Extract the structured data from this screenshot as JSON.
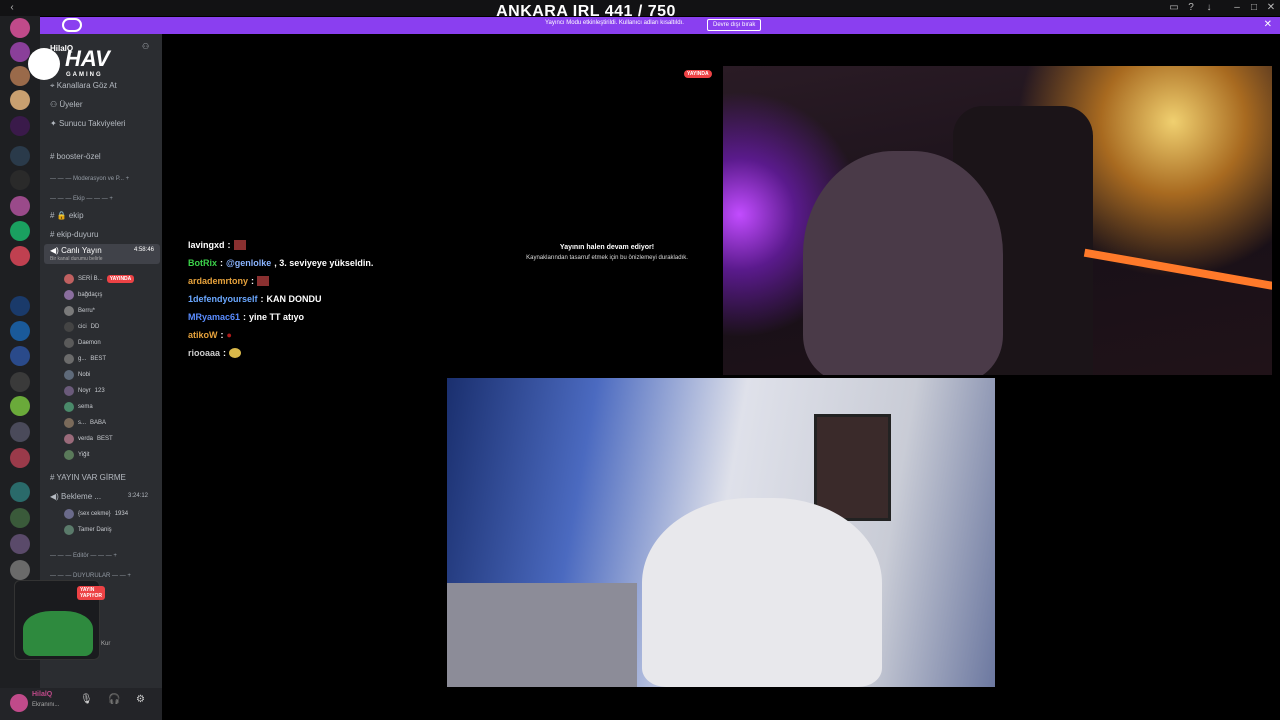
{
  "overlay": {
    "title": "ANKARA IRL 441 / 750"
  },
  "banner": {
    "message": "Yayıncı Modu etkinleştirildi. Kullanıcı adları kısaltıldı.",
    "button_label": "Devre dışı bırak",
    "close_glyph": "✕"
  },
  "server": {
    "name": "HilalQ",
    "logo_text": "HAV",
    "logo_sub": "GAMING"
  },
  "sidebar": {
    "channels": [
      {
        "label": "Kanallara Göz At",
        "icon": "compass-icon"
      },
      {
        "label": "Üyeler",
        "icon": "members-icon"
      },
      {
        "label": "Sunucu Takviyeleri",
        "icon": "boost-icon"
      },
      {
        "label": "booster-özel",
        "icon": "hash-icon"
      },
      {
        "label": "Moderasyon ve P...",
        "icon": "category-icon"
      },
      {
        "label": "Ekip",
        "icon": "category-icon"
      },
      {
        "label": "ekip",
        "icon": "hash-lock-icon"
      },
      {
        "label": "ekip-duyuru",
        "icon": "hash-icon"
      }
    ],
    "voice_channel": {
      "name": "Canlı Yayın",
      "time": "4:58:46",
      "status": "Bir kanal durumu belirle"
    },
    "voice_users": [
      {
        "name": "SERİ B...",
        "badge": "YAYINDA",
        "color": "#c06060"
      },
      {
        "name": "bağdaçış",
        "badge": "",
        "color": "#8a6e9e"
      },
      {
        "name": "Berru*",
        "badge": "",
        "color": "#7a7a7a"
      },
      {
        "name": "cici",
        "badge": "DD",
        "color": "#444"
      },
      {
        "name": "Daemon",
        "badge": "",
        "color": "#5a5a5a"
      },
      {
        "name": "g...",
        "badge": "BEST",
        "color": "#6b6b6b"
      },
      {
        "name": "Nobi",
        "badge": "",
        "color": "#5e6a7a"
      },
      {
        "name": "Noyr",
        "badge": "123",
        "color": "#6a5a7a"
      },
      {
        "name": "sema",
        "badge": "",
        "color": "#4a8a6a"
      },
      {
        "name": "s...",
        "badge": "BABA",
        "color": "#7a6a5a"
      },
      {
        "name": "verda",
        "badge": "BEST",
        "color": "#9a6a7a"
      },
      {
        "name": "Yiğit",
        "badge": "",
        "color": "#5a7a5a"
      }
    ],
    "category_stream": "YAYIN VAR GİRME",
    "waiting_channel": {
      "name": "Bekleme ...",
      "time": "3:24:12"
    },
    "waiting_users": [
      {
        "name": "{sex cekme}",
        "badge": "1934",
        "color": "#6a6a8a"
      },
      {
        "name": "Tamer Daniş",
        "badge": "",
        "color": "#5a7a6a"
      }
    ],
    "category_editor": "Editör",
    "category_announcements": "DUYURULAR",
    "pip_label": "YAYIN YAPIYOR",
    "pip_sub": "Kur"
  },
  "user": {
    "name": "HilalQ",
    "status": "Ekranını..."
  },
  "stream": {
    "paused_title": "Yayının halen devam ediyor!",
    "paused_sub": "Kaynaklarından tasarruf etmek için bu önizlemeyi durakladık.",
    "live_badge": "YAYINDA"
  },
  "chat": [
    {
      "user": "lavingxd",
      "user_color": "#ffffff",
      "sep": " :",
      "mention": "",
      "text": "",
      "emote": "#8a3030"
    },
    {
      "user": "BotRix",
      "user_color": "#3cd24a",
      "sep": " :",
      "mention": "@genlolke",
      "text": ", 3. seviyeye yükseldin.",
      "emote": ""
    },
    {
      "user": "ardademrtony",
      "user_color": "#e6a23c",
      "sep": " :",
      "mention": "",
      "text": "",
      "emote": "#8a3030"
    },
    {
      "user": "1defendyourself",
      "user_color": "#6aa7ff",
      "sep": " :",
      "mention": "",
      "text": " KAN DONDU",
      "emote": ""
    },
    {
      "user": "MRyamac61",
      "user_color": "#5a8cff",
      "sep": " :",
      "mention": "",
      "text": " yine TT atıyo",
      "emote": ""
    },
    {
      "user": "atikoW",
      "user_color": "#e6a23c",
      "sep": " :",
      "mention": "",
      "text": "",
      "emote": "#b01a1a"
    },
    {
      "user": "riooaaa",
      "user_color": "#cccccc",
      "sep": " :",
      "mention": "",
      "text": "",
      "emote": "#d9b84a"
    }
  ],
  "colors": {
    "accent": "#8a3ff0",
    "live_red": "#ed4245",
    "sidebar_bg": "#2b2d31",
    "server_bg": "#1e1f22"
  }
}
